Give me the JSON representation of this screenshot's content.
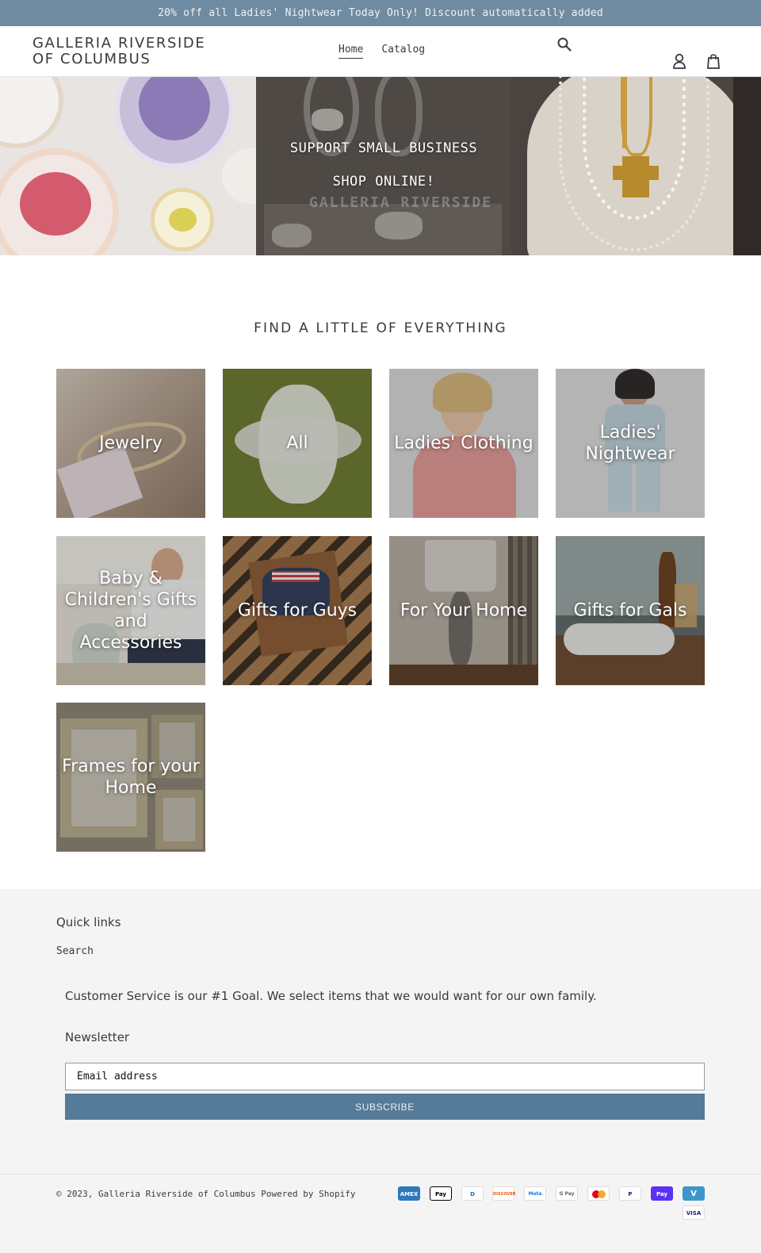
{
  "announcement": "20% off all Ladies' Nightwear Today Only! Discount automatically added",
  "header": {
    "logo_line1": "GALLERIA RIVERSIDE",
    "logo_line2": "OF COLUMBUS",
    "nav": [
      {
        "label": "Home",
        "active": true
      },
      {
        "label": "Catalog",
        "active": false
      }
    ],
    "icons": [
      "search-icon",
      "account-icon",
      "cart-icon"
    ]
  },
  "hero": {
    "line1": "SUPPORT SMALL BUSINESS",
    "line2": "SHOP ONLINE!",
    "watermark": "GALLERIA RIVERSIDE"
  },
  "collections": {
    "title": "FIND A LITTLE OF EVERYTHING",
    "items": [
      {
        "label": "Jewelry"
      },
      {
        "label": "All"
      },
      {
        "label": "Ladies' Clothing"
      },
      {
        "label": "Ladies' Nightwear"
      },
      {
        "label": "Baby & Children's Gifts and Accessories"
      },
      {
        "label": "Gifts for Guys"
      },
      {
        "label": "For Your Home"
      },
      {
        "label": "Gifts for Gals"
      },
      {
        "label": "Frames for your Home"
      }
    ]
  },
  "footer": {
    "quick_links_heading": "Quick links",
    "links": [
      "Search"
    ],
    "tagline": "Customer Service is our #1 Goal. We select items that we would want for our own family.",
    "newsletter_heading": "Newsletter",
    "email_placeholder": "Email address",
    "subscribe_label": "SUBSCRIBE",
    "copyright_prefix": "© 2023,",
    "store_link": "Galleria Riverside of Columbus",
    "powered_by": "Powered by Shopify",
    "payment_methods": [
      {
        "name": "amex-icon",
        "text": "AMEX",
        "color": "#2e77bb"
      },
      {
        "name": "apple-pay-icon",
        "text": "Pay",
        "color": "#000000"
      },
      {
        "name": "diners-club-icon",
        "text": "D",
        "color": "#0079be"
      },
      {
        "name": "discover-icon",
        "text": "DISCOVER",
        "color": "#e65c0b"
      },
      {
        "name": "meta-pay-icon",
        "text": "Meta",
        "color": "#1877f2"
      },
      {
        "name": "google-pay-icon",
        "text": "G Pay",
        "color": "#5f6368"
      },
      {
        "name": "mastercard-icon",
        "text": "",
        "color": "#eb001b"
      },
      {
        "name": "paypal-icon",
        "text": "P",
        "color": "#003087"
      },
      {
        "name": "shop-pay-icon",
        "text": "Pay",
        "color": "#5a31f4"
      },
      {
        "name": "venmo-icon",
        "text": "V",
        "color": "#3d95ce"
      },
      {
        "name": "visa-icon",
        "text": "VISA",
        "color": "#1a1f71"
      }
    ]
  }
}
